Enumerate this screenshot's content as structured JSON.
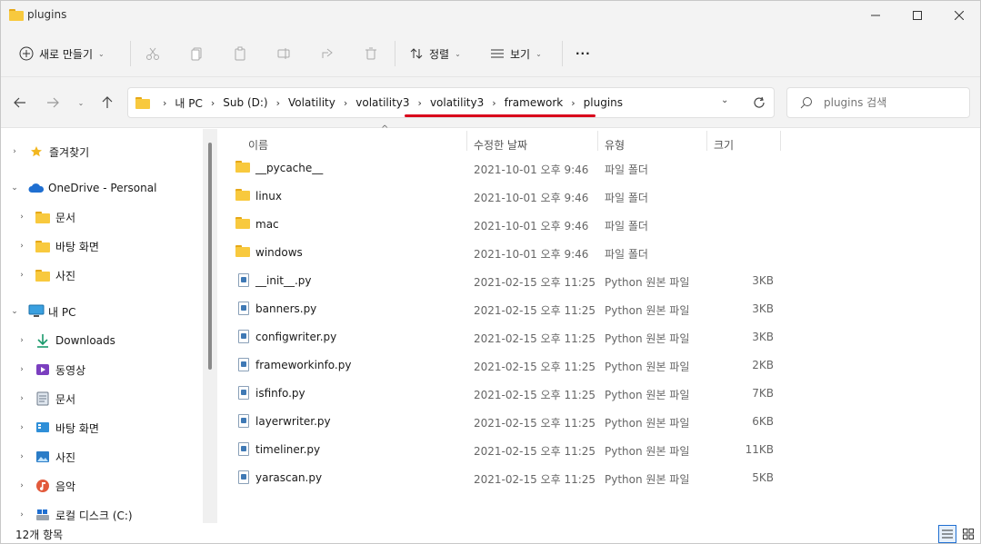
{
  "window": {
    "title": "plugins"
  },
  "toolbar": {
    "new_label": "새로 만들기",
    "sort_label": "정렬",
    "view_label": "보기",
    "more_label": "···"
  },
  "address": {
    "crumbs": [
      "내 PC",
      "Sub (D:)",
      "Volatility",
      "volatility3",
      "volatility3",
      "framework",
      "plugins"
    ],
    "search_placeholder": "plugins 검색"
  },
  "sidebar": {
    "items": [
      {
        "label": "즐겨찾기",
        "icon": "star-icon"
      },
      {
        "label": "OneDrive - Personal",
        "icon": "cloud-icon"
      },
      {
        "label": "문서",
        "icon": "folder-icon"
      },
      {
        "label": "바탕 화면",
        "icon": "folder-icon"
      },
      {
        "label": "사진",
        "icon": "folder-icon"
      },
      {
        "label": "내 PC",
        "icon": "pc-icon"
      },
      {
        "label": "Downloads",
        "icon": "download-icon"
      },
      {
        "label": "동영상",
        "icon": "video-icon"
      },
      {
        "label": "문서",
        "icon": "document-icon"
      },
      {
        "label": "바탕 화면",
        "icon": "desktop-icon"
      },
      {
        "label": "사진",
        "icon": "pictures-icon"
      },
      {
        "label": "음악",
        "icon": "music-icon"
      },
      {
        "label": "로컬 디스크 (C:)",
        "icon": "drive-icon"
      }
    ]
  },
  "columns": {
    "name": "이름",
    "date": "수정한 날짜",
    "type": "유형",
    "size": "크기"
  },
  "files": [
    {
      "name": "__pycache__",
      "date": "2021-10-01 오후 9:46",
      "type": "파일 폴더",
      "size": "",
      "kind": "folder"
    },
    {
      "name": "linux",
      "date": "2021-10-01 오후 9:46",
      "type": "파일 폴더",
      "size": "",
      "kind": "folder"
    },
    {
      "name": "mac",
      "date": "2021-10-01 오후 9:46",
      "type": "파일 폴더",
      "size": "",
      "kind": "folder"
    },
    {
      "name": "windows",
      "date": "2021-10-01 오후 9:46",
      "type": "파일 폴더",
      "size": "",
      "kind": "folder"
    },
    {
      "name": "__init__.py",
      "date": "2021-02-15 오후 11:25",
      "type": "Python 원본 파일",
      "size": "3KB",
      "kind": "py"
    },
    {
      "name": "banners.py",
      "date": "2021-02-15 오후 11:25",
      "type": "Python 원본 파일",
      "size": "3KB",
      "kind": "py"
    },
    {
      "name": "configwriter.py",
      "date": "2021-02-15 오후 11:25",
      "type": "Python 원본 파일",
      "size": "3KB",
      "kind": "py"
    },
    {
      "name": "frameworkinfo.py",
      "date": "2021-02-15 오후 11:25",
      "type": "Python 원본 파일",
      "size": "2KB",
      "kind": "py"
    },
    {
      "name": "isfinfo.py",
      "date": "2021-02-15 오후 11:25",
      "type": "Python 원본 파일",
      "size": "7KB",
      "kind": "py"
    },
    {
      "name": "layerwriter.py",
      "date": "2021-02-15 오후 11:25",
      "type": "Python 원본 파일",
      "size": "6KB",
      "kind": "py"
    },
    {
      "name": "timeliner.py",
      "date": "2021-02-15 오후 11:25",
      "type": "Python 원본 파일",
      "size": "11KB",
      "kind": "py"
    },
    {
      "name": "yarascan.py",
      "date": "2021-02-15 오후 11:25",
      "type": "Python 원본 파일",
      "size": "5KB",
      "kind": "py"
    }
  ],
  "status": {
    "item_count": "12개 항목"
  },
  "colors": {
    "accent": "#1f6fd1",
    "highlight_underline": "#d9001b",
    "folder": "#f8c93e"
  }
}
